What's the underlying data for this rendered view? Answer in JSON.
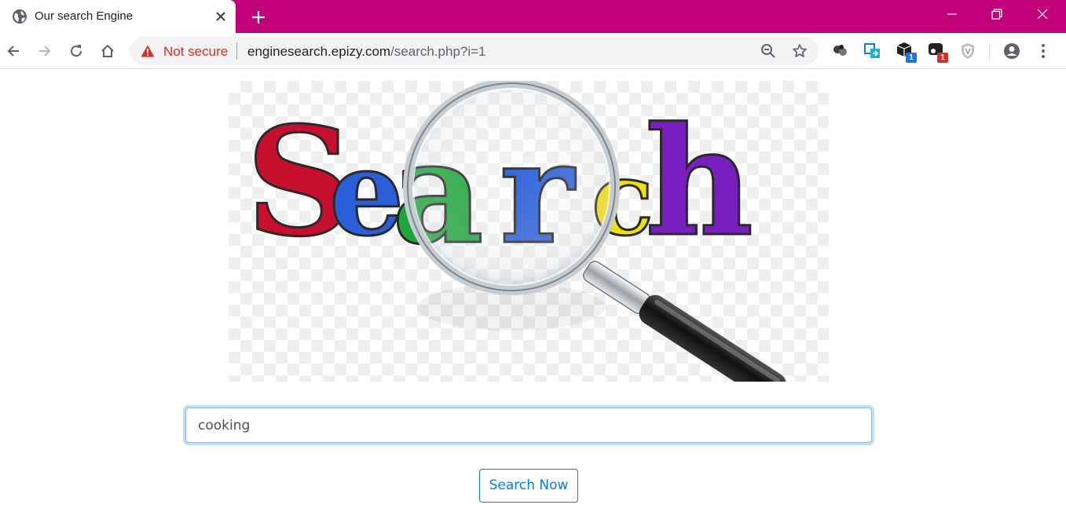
{
  "browser": {
    "tab": {
      "title": "Our search Engine",
      "favicon": "globe-icon"
    },
    "new_tab_icon": "plus-icon",
    "window_controls": [
      "minimize-icon",
      "restore-icon",
      "close-icon"
    ],
    "nav": [
      "back-icon",
      "forward-icon",
      "reload-icon",
      "home-icon"
    ],
    "address_bar": {
      "security_label": "Not secure",
      "url_host": "enginesearch.epizy.com",
      "url_path": "/search.php?i=1"
    },
    "extensions": [
      {
        "icon": "extension-spheres-icon"
      },
      {
        "icon": "extension-translate-icon"
      },
      {
        "icon": "extension-cube-icon",
        "badge": "1",
        "badge_color": "#1a73e8"
      },
      {
        "icon": "extension-tracker-icon",
        "badge": "1",
        "badge_color": "#d93025"
      },
      {
        "icon": "extension-shield-icon"
      }
    ],
    "accent_color": "#c2007a"
  },
  "page": {
    "hero_logo": {
      "text": "Search",
      "letter_colors": [
        "#c8102e",
        "#2b5fd9",
        "#1fa53a",
        "#2b5fd9",
        "#f2e000",
        "#7a1fbf"
      ]
    },
    "search": {
      "value": "cooking"
    },
    "submit_label": "Search Now"
  }
}
